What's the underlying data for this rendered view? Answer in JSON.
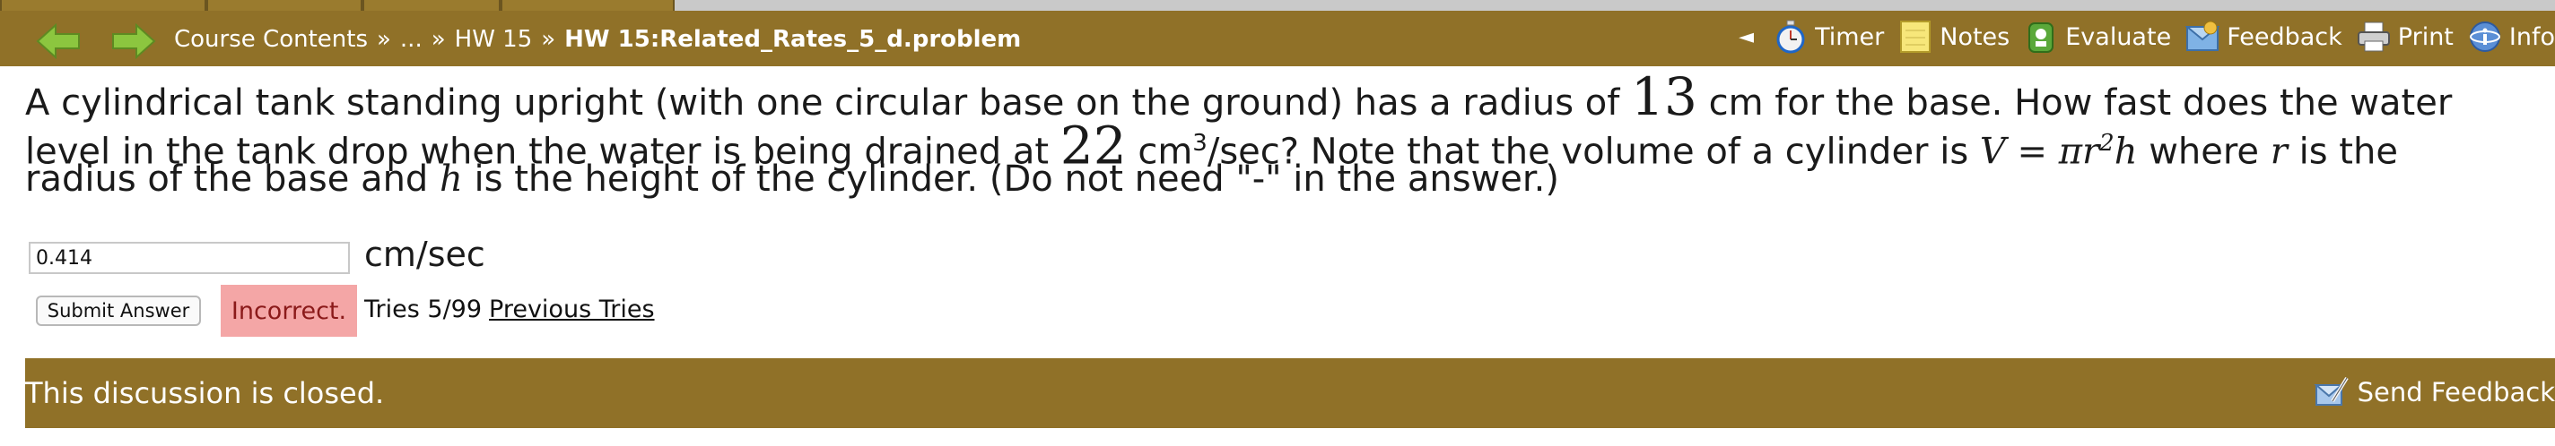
{
  "nav": {
    "breadcrumb": [
      "Course Contents",
      "»",
      "...",
      "»",
      "HW 15",
      "»"
    ],
    "current_problem": "HW 15:Related_Rates_5_d.problem",
    "collapse_symbol": "◄",
    "tools": {
      "timer": "Timer",
      "notes": "Notes",
      "evaluate": "Evaluate",
      "feedback": "Feedback",
      "print": "Print",
      "info": "Info"
    }
  },
  "problem": {
    "line1_a": "A cylindrical tank standing upright (with one circular base on the ground) has a radius of",
    "radius": "13",
    "line1_b": "cm for the base. How fast does the water",
    "line2_a": "level in the tank drop when the water is being drained at",
    "rate": "22",
    "unit_cm": "cm",
    "unit_exp": "3",
    "line2_b": "/sec? Note that the volume of a cylinder is",
    "formula_lhs": "V",
    "formula_eq": " = ",
    "formula_rhs_a": "πr",
    "formula_rhs_exp": "2",
    "formula_rhs_b": "h",
    "line2_c": "where",
    "var_r": "r",
    "line2_d": "is the",
    "line3_a": "radius of the base and",
    "var_h": "h",
    "line3_b": "is the height of the cylinder. (Do not need \"-\" in the answer.)"
  },
  "answer": {
    "value": "0.414",
    "unit": "cm/sec",
    "submit_label": "Submit Answer",
    "status": "Incorrect.",
    "tries": "Tries 5/99",
    "previous_tries": "Previous Tries"
  },
  "discussion": {
    "message": "This discussion is closed.",
    "send_feedback": "Send Feedback"
  },
  "colors": {
    "bar": "#907128",
    "incorrect_bg": "#f4a6a6",
    "incorrect_text": "#8b1a1a",
    "arrow_green": "#8cc63f"
  }
}
